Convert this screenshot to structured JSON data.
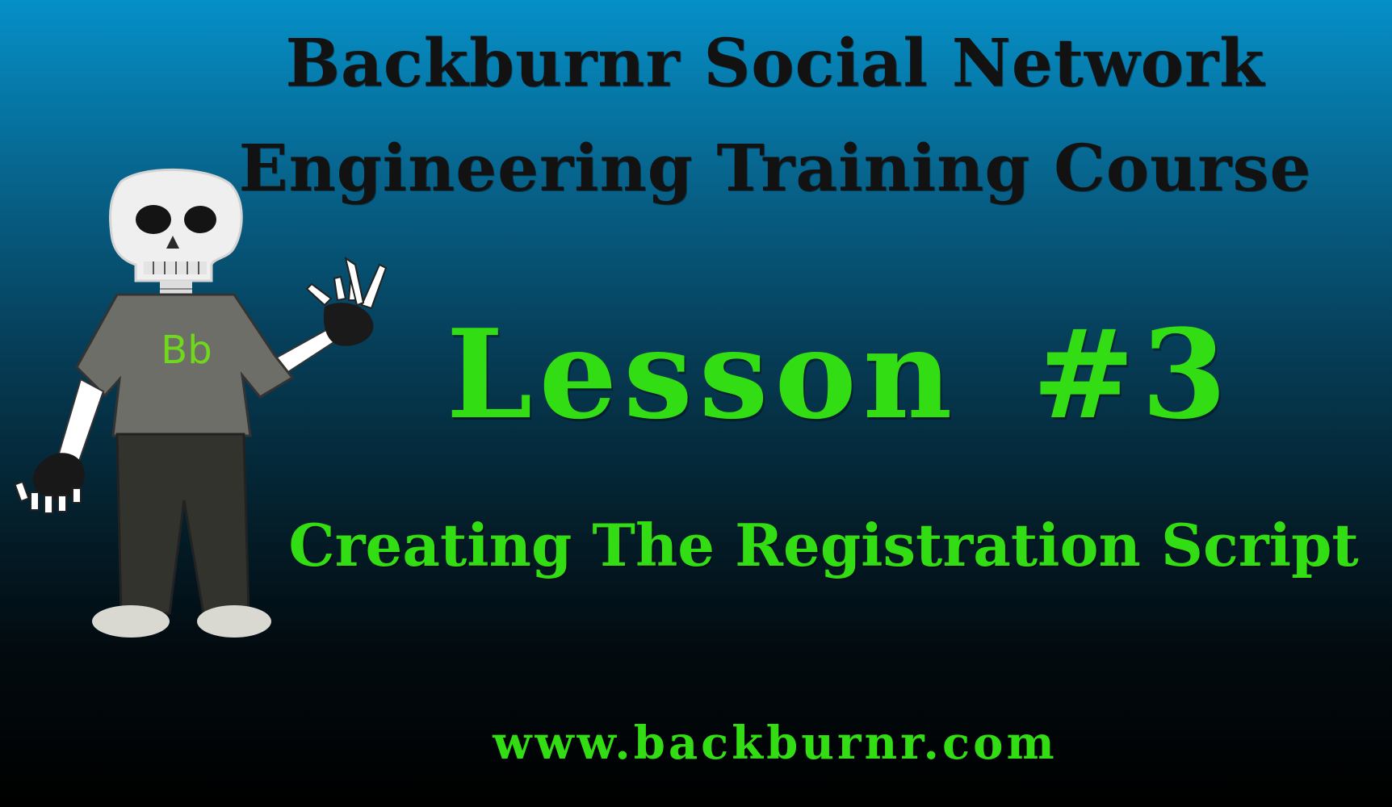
{
  "slide": {
    "title_line1": "Backburnr Social Network",
    "title_line2": "Engineering Training Course",
    "lesson": "Lesson #3",
    "subtitle": "Creating The Registration Script",
    "url": "www.backburnr.com"
  },
  "mascot": {
    "shirt_logo": "Bb",
    "icon": "skeleton-mascot-icon"
  },
  "colors": {
    "title": "#121212",
    "accent_green": "#33dd14",
    "background_top": "#0590c8",
    "background_bottom": "#000000"
  }
}
